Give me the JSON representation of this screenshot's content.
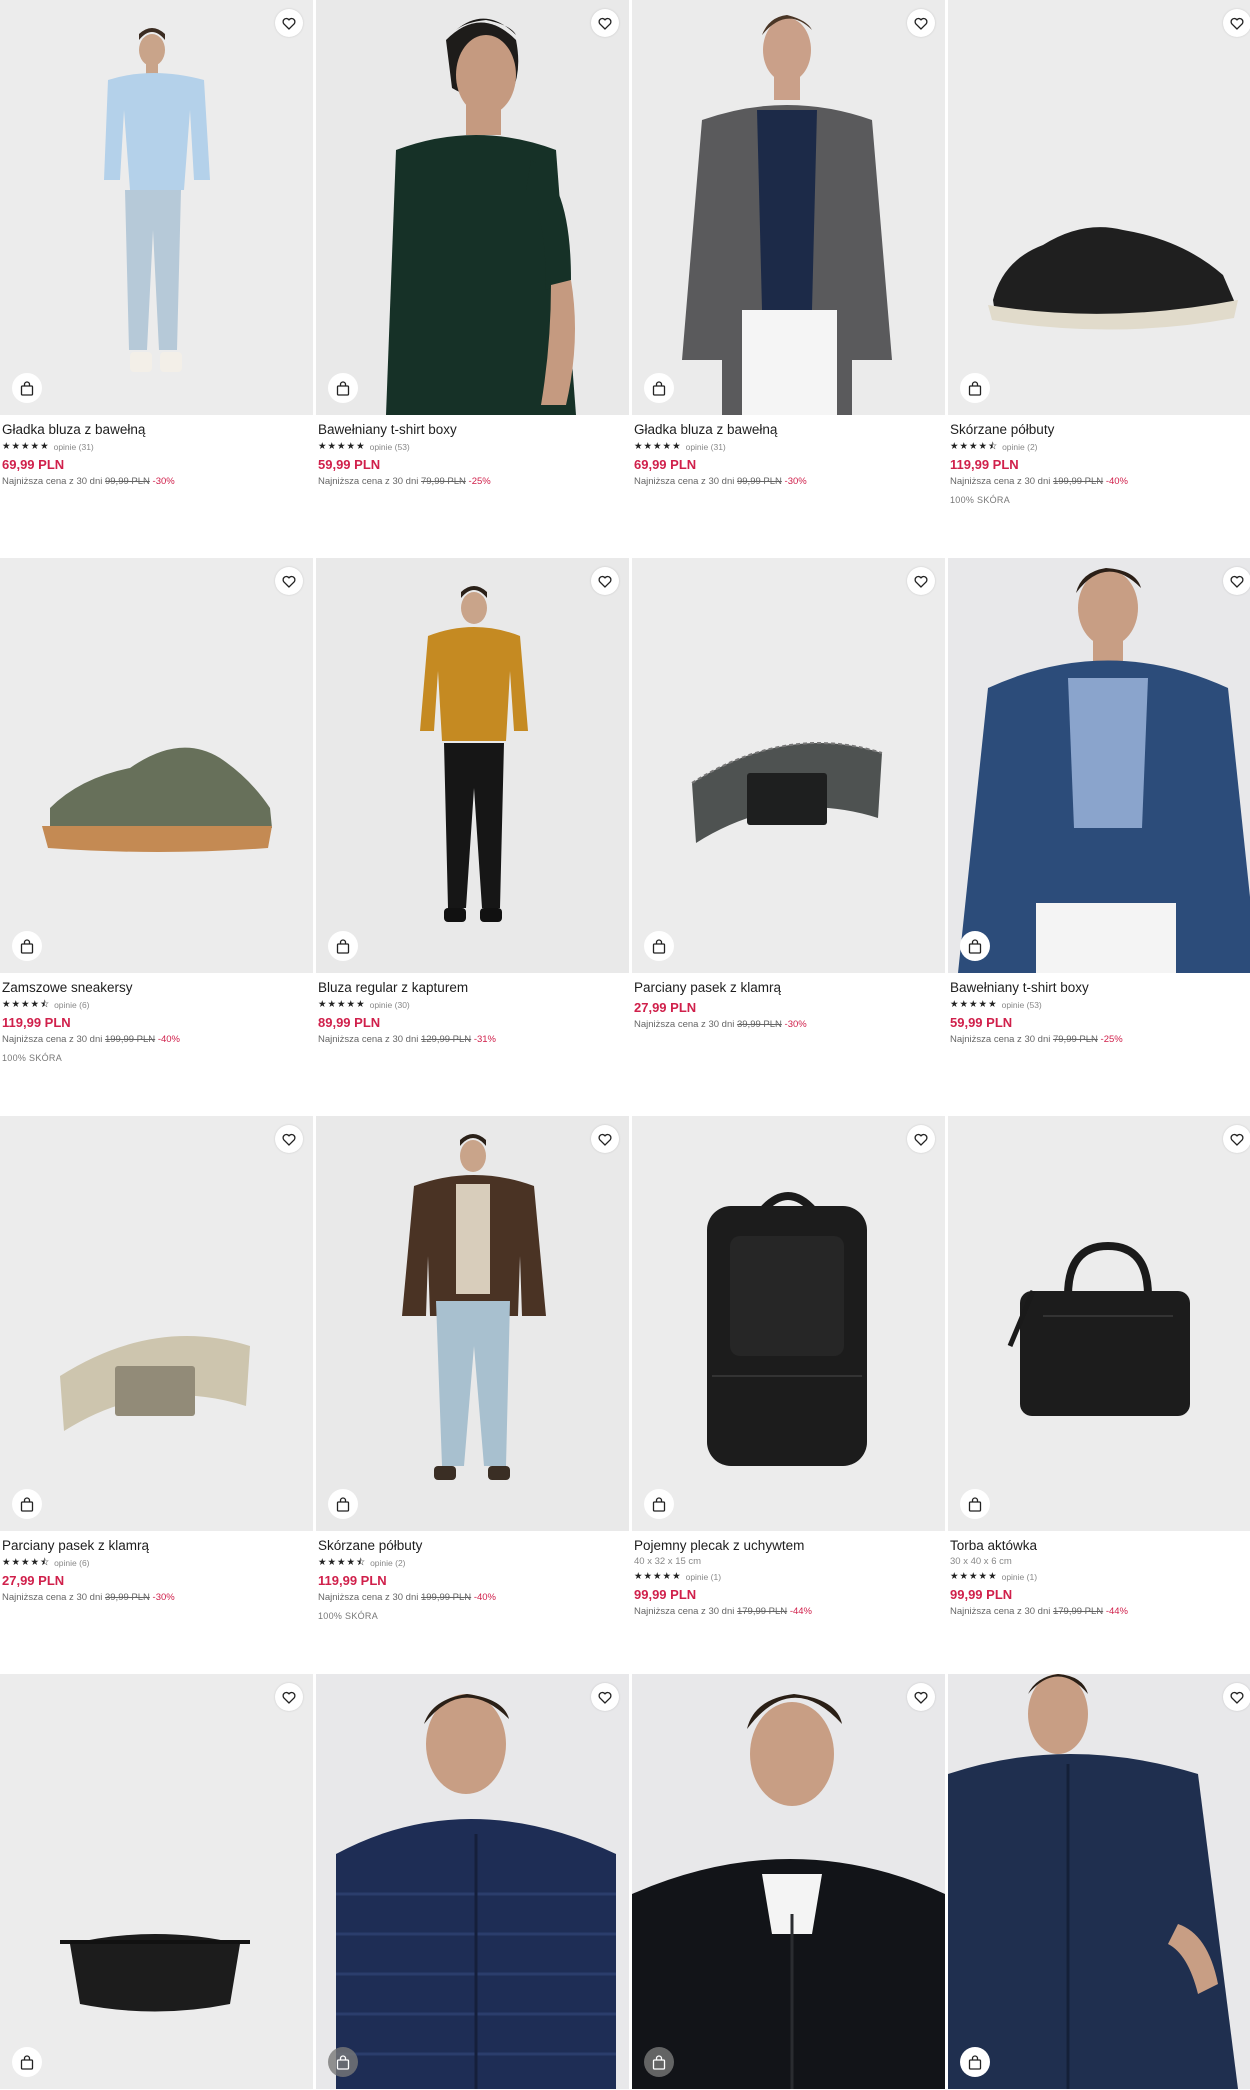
{
  "colors": {
    "accent": "#d0204b",
    "text": "#1e1e1e",
    "muted": "#888888",
    "image_bg": "#ececec"
  },
  "icons": {
    "favorite": "heart-outline-icon",
    "cart": "shopping-bag-icon",
    "star": "star-icon"
  },
  "lowest_label": "Najniższa cena z 30 dni",
  "products": [
    {
      "name": "Gładka bluza z bawełną",
      "stars": "★★★★★",
      "reviews": "opinie (31)",
      "price": "69,99 PLN",
      "old_price": "99,99 PLN",
      "discount": "-30%",
      "material": ""
    },
    {
      "name": "Bawełniany t-shirt boxy",
      "stars": "★★★★★",
      "reviews": "opinie (53)",
      "price": "59,99 PLN",
      "old_price": "79,99 PLN",
      "discount": "-25%",
      "material": ""
    },
    {
      "name": "Gładka bluza z bawełną",
      "stars": "★★★★★",
      "reviews": "opinie (31)",
      "price": "69,99 PLN",
      "old_price": "99,99 PLN",
      "discount": "-30%",
      "material": ""
    },
    {
      "name": "Skórzane półbuty",
      "stars": "★★★★⯪",
      "reviews": "opinie (2)",
      "price": "119,99 PLN",
      "old_price": "199,99 PLN",
      "discount": "-40%",
      "material": "100% SKÓRA"
    },
    {
      "name": "Zamszowe sneakersy",
      "stars": "★★★★⯪",
      "reviews": "opinie (6)",
      "price": "119,99 PLN",
      "old_price": "199,99 PLN",
      "discount": "-40%",
      "material": "100% SKÓRA"
    },
    {
      "name": "Bluza regular z kapturem",
      "stars": "★★★★★",
      "reviews": "opinie (30)",
      "price": "89,99 PLN",
      "old_price": "129,99 PLN",
      "discount": "-31%",
      "material": ""
    },
    {
      "name": "Parciany pasek z klamrą",
      "stars": "",
      "reviews": "",
      "price": "27,99 PLN",
      "old_price": "39,99 PLN",
      "discount": "-30%",
      "material": ""
    },
    {
      "name": "Bawełniany t-shirt boxy",
      "stars": "★★★★★",
      "reviews": "opinie (53)",
      "price": "59,99 PLN",
      "old_price": "79,99 PLN",
      "discount": "-25%",
      "material": ""
    },
    {
      "name": "Parciany pasek z klamrą",
      "stars": "★★★★⯪",
      "reviews": "opinie (6)",
      "price": "27,99 PLN",
      "old_price": "39,99 PLN",
      "discount": "-30%",
      "material": ""
    },
    {
      "name": "Skórzane półbuty",
      "stars": "★★★★⯪",
      "reviews": "opinie (2)",
      "price": "119,99 PLN",
      "old_price": "199,99 PLN",
      "discount": "-40%",
      "material": "100% SKÓRA"
    },
    {
      "name": "Pojemny plecak z uchywtem",
      "dims": "40 x 32 x 15 cm",
      "stars": "★★★★★",
      "reviews": "opinie (1)",
      "price": "99,99 PLN",
      "old_price": "179,99 PLN",
      "discount": "-44%",
      "material": ""
    },
    {
      "name": "Torba aktówka",
      "dims": "30 x 40 x 6 cm",
      "stars": "★★★★★",
      "reviews": "opinie (1)",
      "price": "99,99 PLN",
      "old_price": "179,99 PLN",
      "discount": "-44%",
      "material": ""
    }
  ]
}
